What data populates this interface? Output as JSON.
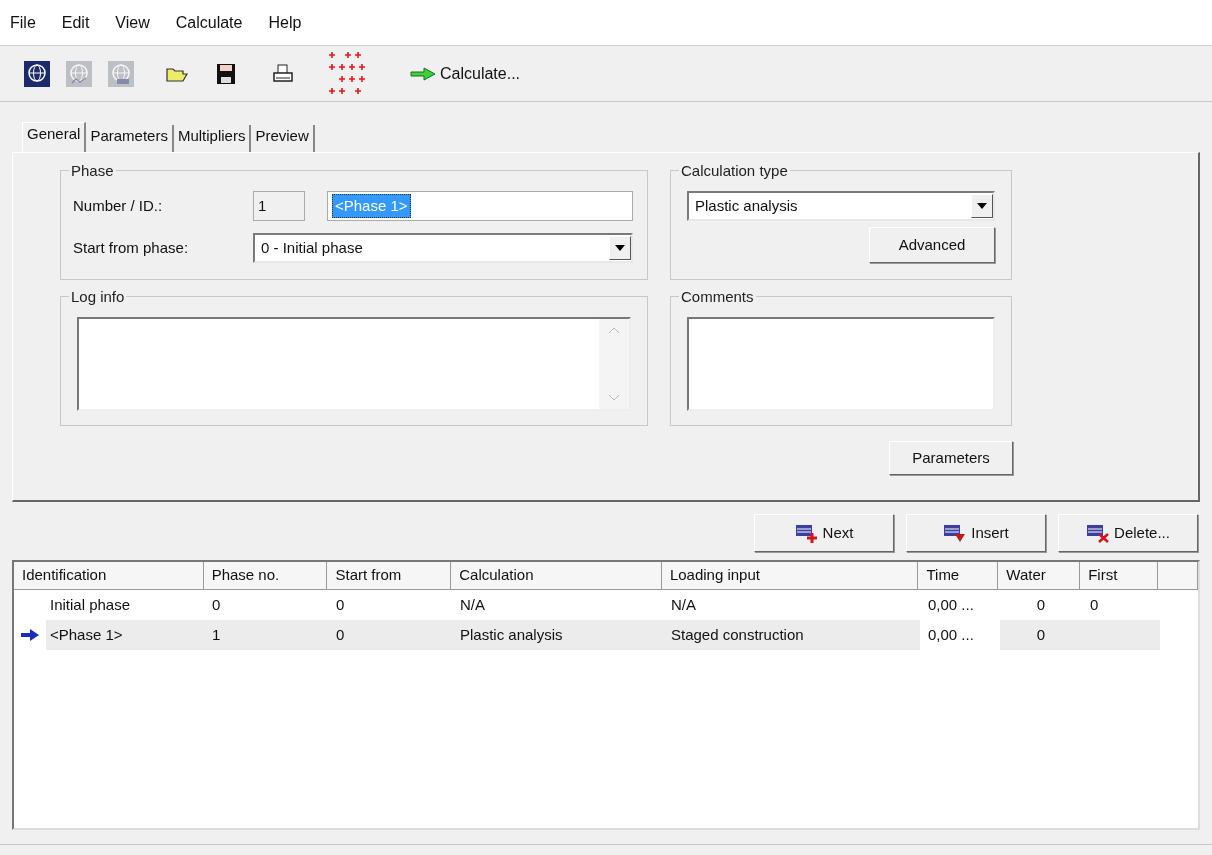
{
  "menu": [
    "File",
    "Edit",
    "View",
    "Calculate",
    "Help"
  ],
  "toolbar": {
    "buttons": [
      {
        "kind": "globe",
        "disabled": false
      },
      {
        "kind": "globe-plot",
        "disabled": true
      },
      {
        "kind": "globe-table",
        "disabled": true
      },
      {
        "kind": "open"
      },
      {
        "kind": "save"
      },
      {
        "kind": "print"
      },
      {
        "kind": "points"
      }
    ],
    "calculate": "Calculate..."
  },
  "tabs": [
    {
      "label": "General",
      "selected": true
    },
    {
      "label": "Parameters",
      "selected": false
    },
    {
      "label": "Multipliers",
      "selected": false
    },
    {
      "label": "Preview",
      "selected": false
    }
  ],
  "phase": {
    "title": "Phase",
    "number_label": "Number / ID.:",
    "number": "1",
    "id": "<Phase 1>",
    "start_label": "Start from phase:",
    "start": "0 - Initial phase"
  },
  "calculation_type": {
    "title": "Calculation type",
    "value": "Plastic analysis",
    "advanced": "Advanced"
  },
  "log_info": {
    "title": "Log info"
  },
  "comments": {
    "title": "Comments"
  },
  "parameters_button": "Parameters",
  "actions": [
    "Next",
    "Insert",
    "Delete..."
  ],
  "table": {
    "columns": [
      "Identification",
      "Phase no.",
      "Start from",
      "Calculation",
      "Loading input",
      "Time",
      "Water",
      "First"
    ],
    "rows": [
      {
        "selected": false,
        "cells": [
          "Initial phase",
          "0",
          "0",
          "N/A",
          "N/A",
          "0,00 ...",
          "0",
          "0"
        ]
      },
      {
        "selected": true,
        "cells": [
          "<Phase 1>",
          "1",
          "0",
          "Plastic analysis",
          "Staged construction",
          "0,00 ...",
          "0",
          ""
        ]
      }
    ]
  }
}
